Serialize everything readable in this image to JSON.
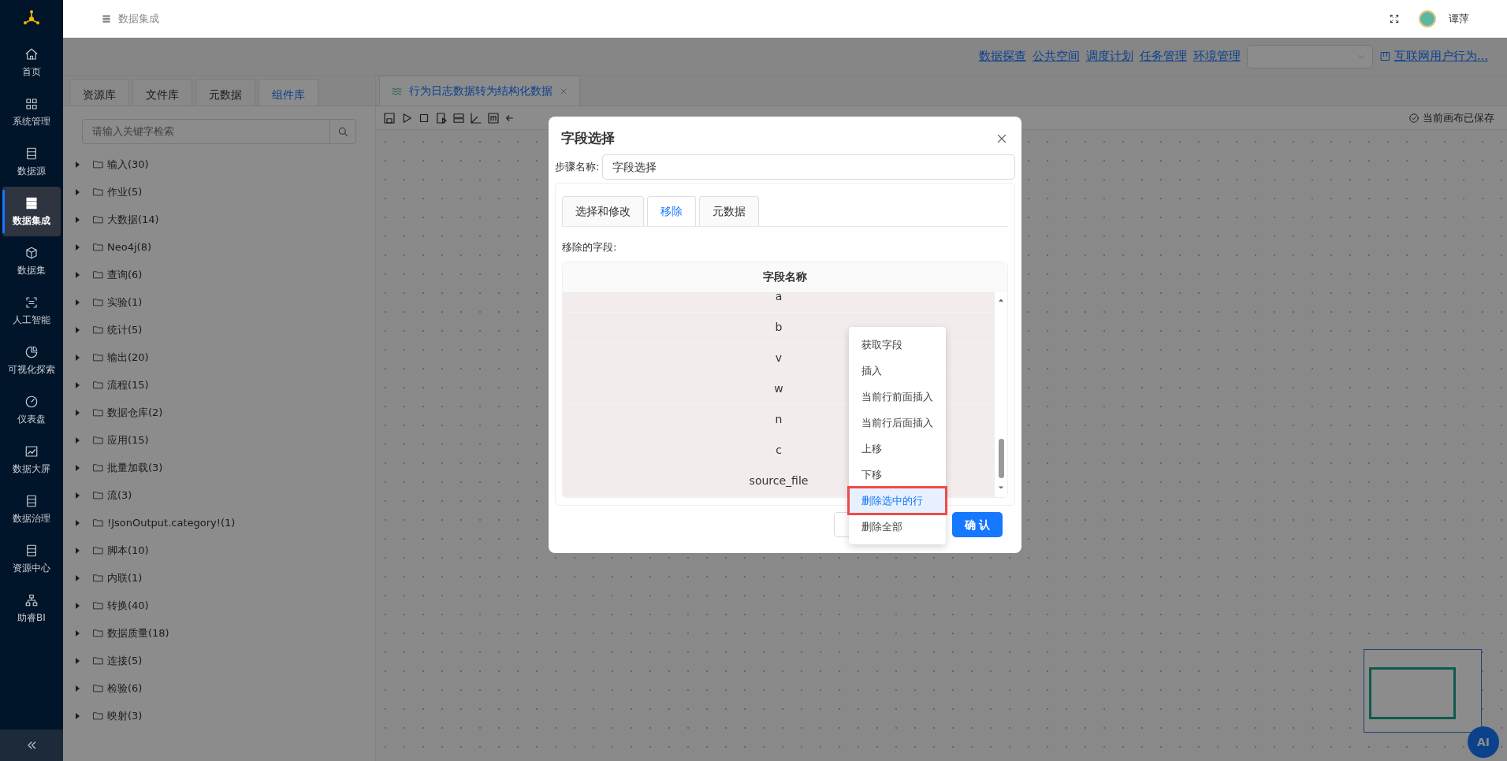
{
  "header": {
    "breadcrumb": "数据集成",
    "user": "谭萍"
  },
  "sidebar": {
    "items": [
      {
        "label": "首页",
        "selected": false
      },
      {
        "label": "系统管理",
        "selected": false
      },
      {
        "label": "数据源",
        "selected": false
      },
      {
        "label": "数据集成",
        "selected": true
      },
      {
        "label": "数据集",
        "selected": false
      },
      {
        "label": "人工智能",
        "selected": false
      },
      {
        "label": "可视化探索",
        "selected": false
      },
      {
        "label": "仪表盘",
        "selected": false
      },
      {
        "label": "数据大屏",
        "selected": false
      },
      {
        "label": "数据治理",
        "selected": false
      },
      {
        "label": "资源中心",
        "selected": false
      },
      {
        "label": "助睿BI",
        "selected": false
      }
    ]
  },
  "top_links": [
    "数据探查",
    "公共空间",
    "调度计划",
    "任务管理",
    "环境管理"
  ],
  "project_link": "互联网用户行为...",
  "left_tabs": [
    {
      "label": "资源库",
      "selected": false
    },
    {
      "label": "文件库",
      "selected": false
    },
    {
      "label": "元数据",
      "selected": false
    },
    {
      "label": "组件库",
      "selected": true
    }
  ],
  "search": {
    "placeholder": "请输入关键字检索"
  },
  "tree": [
    {
      "label": "输入(30)",
      "expanded": false
    },
    {
      "label": "作业(5)",
      "expanded": false
    },
    {
      "label": "大数据(14)",
      "expanded": false
    },
    {
      "label": "Neo4j(8)",
      "expanded": false
    },
    {
      "label": "查询(6)",
      "expanded": false
    },
    {
      "label": "实验(1)",
      "expanded": false
    },
    {
      "label": "统计(5)",
      "expanded": false
    },
    {
      "label": "输出(20)",
      "expanded": false
    },
    {
      "label": "流程(15)",
      "expanded": false
    },
    {
      "label": "数据仓库(2)",
      "expanded": false
    },
    {
      "label": "应用(15)",
      "expanded": false
    },
    {
      "label": "批量加载(3)",
      "expanded": false
    },
    {
      "label": "流(3)",
      "expanded": false
    },
    {
      "label": "!JsonOutput.category!(1)",
      "expanded": false
    },
    {
      "label": "脚本(10)",
      "expanded": false
    },
    {
      "label": "内联(1)",
      "expanded": false
    },
    {
      "label": "转换(40)",
      "expanded": false
    },
    {
      "label": "数据质量(18)",
      "expanded": false
    },
    {
      "label": "连接(5)",
      "expanded": false
    },
    {
      "label": "检验(6)",
      "expanded": false
    },
    {
      "label": "映射(3)",
      "expanded": false
    }
  ],
  "editor_tab": {
    "title": "行为日志数据转为结构化数据"
  },
  "save_status": "当前画布已保存",
  "dialog": {
    "title": "字段选择",
    "step_label": "步骤名称:",
    "step_name": "字段选择",
    "tabs": [
      {
        "label": "选择和修改",
        "selected": false
      },
      {
        "label": "移除",
        "selected": true
      },
      {
        "label": "元数据",
        "selected": false
      }
    ],
    "section_label": "移除的字段:",
    "table": {
      "columns": [
        "字段名称"
      ],
      "rows": [
        {
          "name": "a",
          "selected": true
        },
        {
          "name": "b",
          "selected": true
        },
        {
          "name": "v",
          "selected": true
        },
        {
          "name": "w",
          "selected": true
        },
        {
          "name": "n",
          "selected": true
        },
        {
          "name": "c",
          "selected": true
        },
        {
          "name": "source_file",
          "selected": true
        }
      ]
    },
    "context_menu": [
      {
        "label": "获取字段",
        "selected": false
      },
      {
        "label": "插入",
        "selected": false
      },
      {
        "label": "当前行前面插入",
        "selected": false
      },
      {
        "label": "当前行后面插入",
        "selected": false
      },
      {
        "label": "上移",
        "selected": false
      },
      {
        "label": "下移",
        "selected": false
      },
      {
        "label": "删除选中的行",
        "selected": true
      },
      {
        "label": "删除全部",
        "selected": false
      }
    ],
    "confirm": "确 认"
  },
  "ai_button": "AI"
}
